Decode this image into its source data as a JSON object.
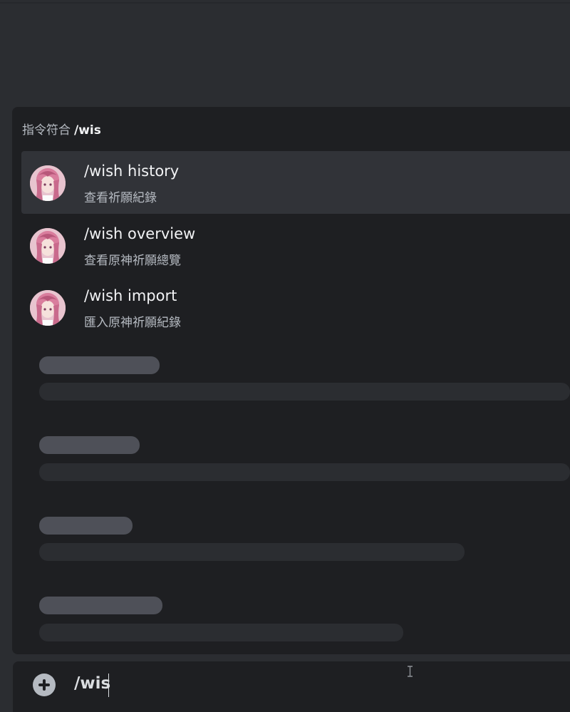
{
  "autocomplete": {
    "header_prefix": "指令符合",
    "header_query": "/wis",
    "commands": [
      {
        "name": "/wish history",
        "description": "查看祈願紀錄",
        "icon": "bot-avatar",
        "selected": true
      },
      {
        "name": "/wish overview",
        "description": "查看原神祈願總覽",
        "icon": "bot-avatar",
        "selected": false
      },
      {
        "name": "/wish import",
        "description": "匯入原神祈願紀錄",
        "icon": "bot-avatar",
        "selected": false
      }
    ]
  },
  "chat_input": {
    "value": "/wis",
    "attach_icon": "plus-circle-icon"
  },
  "colors": {
    "background": "#2b2d31",
    "popout": "#1e1f22",
    "selected_row": "#313338",
    "skeleton_title": "#4e5058",
    "skeleton_line": "#2b2d31"
  }
}
